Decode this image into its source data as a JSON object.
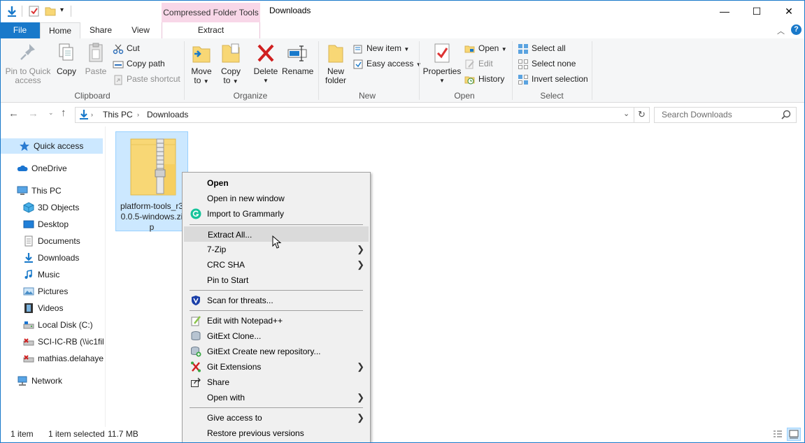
{
  "titlebar": {
    "title": "Downloads",
    "contextual_tab_group": "Compressed Folder Tools",
    "minimize_glyph": "—",
    "maximize_glyph": "☐",
    "close_glyph": "✕"
  },
  "tabs": {
    "file": "File",
    "home": "Home",
    "share": "Share",
    "view": "View",
    "extract": "Extract"
  },
  "ribbon": {
    "clipboard": {
      "group_label": "Clipboard",
      "pin_line1": "Pin to Quick",
      "pin_line2": "access",
      "copy": "Copy",
      "paste": "Paste",
      "cut": "Cut",
      "copy_path": "Copy path",
      "paste_shortcut": "Paste shortcut"
    },
    "organize": {
      "group_label": "Organize",
      "move_to_line1": "Move",
      "move_to_line2": "to",
      "copy_to_line1": "Copy",
      "copy_to_line2": "to",
      "delete": "Delete",
      "rename": "Rename"
    },
    "new": {
      "group_label": "New",
      "new_folder_line1": "New",
      "new_folder_line2": "folder",
      "new_item": "New item",
      "easy_access": "Easy access"
    },
    "open": {
      "group_label": "Open",
      "properties": "Properties",
      "open": "Open",
      "edit": "Edit",
      "history": "History"
    },
    "select": {
      "group_label": "Select",
      "select_all": "Select all",
      "select_none": "Select none",
      "invert_selection": "Invert selection"
    }
  },
  "address": {
    "crumbs": [
      "This PC",
      "Downloads"
    ],
    "search_placeholder": "Search Downloads"
  },
  "nav": {
    "items": [
      {
        "label": "Quick access",
        "icon": "star-icon"
      },
      {
        "label": "OneDrive",
        "icon": "cloud-icon"
      },
      {
        "label": "This PC",
        "icon": "computer-icon"
      },
      {
        "label": "3D Objects",
        "icon": "cube-icon"
      },
      {
        "label": "Desktop",
        "icon": "desktop-icon"
      },
      {
        "label": "Documents",
        "icon": "document-icon"
      },
      {
        "label": "Downloads",
        "icon": "download-arrow-icon"
      },
      {
        "label": "Music",
        "icon": "music-note-icon"
      },
      {
        "label": "Pictures",
        "icon": "picture-icon"
      },
      {
        "label": "Videos",
        "icon": "film-icon"
      },
      {
        "label": "Local Disk (C:)",
        "icon": "drive-icon"
      },
      {
        "label": "SCI-IC-RB (\\\\ic1fil",
        "icon": "network-drive-icon"
      },
      {
        "label": "mathias.delahaye",
        "icon": "network-drive-icon"
      },
      {
        "label": "Network",
        "icon": "network-icon"
      }
    ]
  },
  "file": {
    "name": "platform-tools_r30.0.5-windows.zip",
    "name_display": "platform-tools_r3 0.0.5-windows.zi p"
  },
  "status": {
    "count": "1 item",
    "selected": "1 item selected",
    "size": "11.7 MB"
  },
  "context_menu": {
    "items": [
      {
        "label": "Open"
      },
      {
        "label": "Open in new window"
      },
      {
        "label": "Import to Grammarly"
      },
      {
        "label": "Extract All..."
      },
      {
        "label": "7-Zip"
      },
      {
        "label": "CRC SHA"
      },
      {
        "label": "Pin to Start"
      },
      {
        "label": "Scan for threats..."
      },
      {
        "label": "Edit with Notepad++"
      },
      {
        "label": "GitExt Clone..."
      },
      {
        "label": "GitExt Create new repository..."
      },
      {
        "label": "Git Extensions"
      },
      {
        "label": "Share"
      },
      {
        "label": "Open with"
      },
      {
        "label": "Give access to"
      },
      {
        "label": "Restore previous versions"
      }
    ]
  },
  "colors": {
    "accent": "#1979ca",
    "selection": "#cce8ff",
    "context_tab": "#f8d7e8",
    "delete_red": "#d02020",
    "folder_yellow": "#f8d775"
  }
}
